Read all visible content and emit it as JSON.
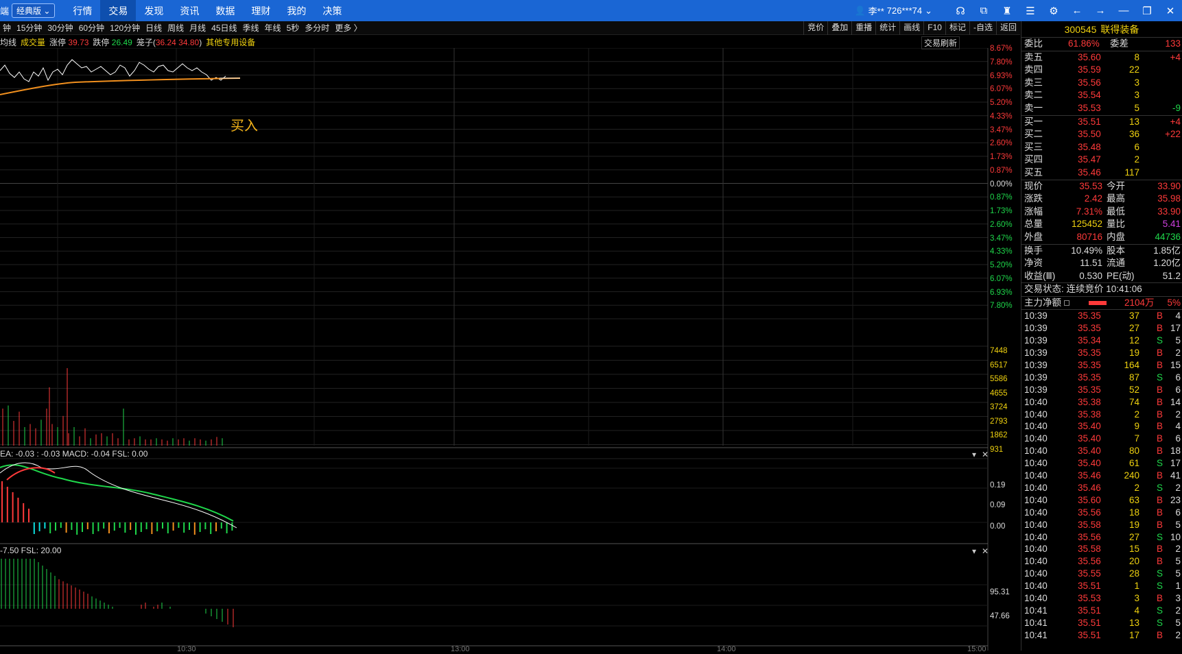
{
  "topbar": {
    "brand": "端",
    "edition": "经典版",
    "menu": [
      "行情",
      "交易",
      "发现",
      "资讯",
      "数据",
      "理财",
      "我的",
      "决策"
    ],
    "active_menu": "交易",
    "user_name": "李**",
    "user_account": "726***74"
  },
  "toolbar": {
    "periods": [
      "钟",
      "15分钟",
      "30分钟",
      "60分钟",
      "120分钟",
      "日线",
      "周线",
      "月线",
      "45日线",
      "季线",
      "年线",
      "5秒",
      "多分时",
      "更多 〉"
    ],
    "tools": [
      "竞价",
      "叠加",
      "重播",
      "统计",
      "画线",
      "F10",
      "标记",
      "-自选",
      "返回"
    ]
  },
  "infobar": {
    "kind": "均线",
    "vol": "成交量",
    "limit_up_label": "涨停",
    "limit_up": "39.73",
    "limit_down_label": "跌停",
    "limit_down": "26.49",
    "box_label": "笼子(",
    "box": "36.24 34.80",
    ")": ")",
    "sector": "其他专用设备",
    "refresh": "交易刷新"
  },
  "annotation": {
    "buy": "买入"
  },
  "price_axis": {
    "up": [
      "8.67%",
      "7.80%",
      "6.93%",
      "6.07%",
      "5.20%",
      "4.33%",
      "3.47%",
      "2.60%",
      "1.73%",
      "0.87%"
    ],
    "zero": "0.00%",
    "down": [
      "0.87%",
      "1.73%",
      "2.60%",
      "3.47%",
      "4.33%",
      "5.20%",
      "6.07%",
      "6.93%",
      "7.80%"
    ]
  },
  "vol_axis": [
    "7448",
    "6517",
    "5586",
    "4655",
    "3724",
    "2793",
    "1862",
    "931"
  ],
  "macd": {
    "header": "EA: -0.03  : -0.03  MACD: -0.04  FSL: 0.00",
    "axis": [
      "0.19",
      "0.09",
      "0.00"
    ]
  },
  "kdj": {
    "header": "-7.50  FSL: 20.00",
    "axis": [
      "95.31",
      "47.66"
    ]
  },
  "time_axis": [
    "10:30",
    "13:00",
    "14:00",
    "15:00"
  ],
  "side": {
    "code": "300545",
    "name": "联得装备",
    "weibi_label": "委比",
    "weibi": "61.86%",
    "weicha_label": "委差",
    "weicha": "133",
    "asks": [
      {
        "label": "卖五",
        "price": "35.60",
        "vol": "8",
        "chg": "+4"
      },
      {
        "label": "卖四",
        "price": "35.59",
        "vol": "22",
        "chg": ""
      },
      {
        "label": "卖三",
        "price": "35.56",
        "vol": "3",
        "chg": ""
      },
      {
        "label": "卖二",
        "price": "35.54",
        "vol": "3",
        "chg": ""
      },
      {
        "label": "卖一",
        "price": "35.53",
        "vol": "5",
        "chg": "-9"
      }
    ],
    "bids": [
      {
        "label": "买一",
        "price": "35.51",
        "vol": "13",
        "chg": "+4"
      },
      {
        "label": "买二",
        "price": "35.50",
        "vol": "36",
        "chg": "+22"
      },
      {
        "label": "买三",
        "price": "35.48",
        "vol": "6",
        "chg": ""
      },
      {
        "label": "买四",
        "price": "35.47",
        "vol": "2",
        "chg": ""
      },
      {
        "label": "买五",
        "price": "35.46",
        "vol": "117",
        "chg": ""
      }
    ],
    "quote": [
      {
        "l1": "现价",
        "v1": "35.53",
        "c1": "red",
        "l2": "今开",
        "v2": "33.90",
        "c2": "red"
      },
      {
        "l1": "涨跌",
        "v1": "2.42",
        "c1": "red",
        "l2": "最高",
        "v2": "35.98",
        "c2": "red"
      },
      {
        "l1": "涨幅",
        "v1": "7.31%",
        "c1": "red",
        "l2": "最低",
        "v2": "33.90",
        "c2": "red"
      },
      {
        "l1": "总量",
        "v1": "125452",
        "c1": "yellow",
        "l2": "量比",
        "v2": "5.41",
        "c2": "mag"
      },
      {
        "l1": "外盘",
        "v1": "80716",
        "c1": "red",
        "l2": "内盘",
        "v2": "44736",
        "c2": "green"
      }
    ],
    "stats": [
      {
        "l1": "换手",
        "v1": "10.49%",
        "l2": "股本",
        "v2": "1.85亿"
      },
      {
        "l1": "净资",
        "v1": "11.51",
        "l2": "流通",
        "v2": "1.20亿"
      },
      {
        "l1": "收益(Ⅲ)",
        "v1": "0.530",
        "l2": "PE(动)",
        "v2": "51.2"
      }
    ],
    "status": "交易状态: 连续竞价 10:41:06",
    "main_flow_label": "主力净额",
    "main_flow": "2104万",
    "main_flow_pct": "5%",
    "ticks": [
      {
        "t": "10:39",
        "p": "35.35",
        "v": "37",
        "bs": "B",
        "n": "4"
      },
      {
        "t": "10:39",
        "p": "35.35",
        "v": "27",
        "bs": "B",
        "n": "17"
      },
      {
        "t": "10:39",
        "p": "35.34",
        "v": "12",
        "bs": "S",
        "n": "5"
      },
      {
        "t": "10:39",
        "p": "35.35",
        "v": "19",
        "bs": "B",
        "n": "2"
      },
      {
        "t": "10:39",
        "p": "35.35",
        "v": "164",
        "bs": "B",
        "n": "15"
      },
      {
        "t": "10:39",
        "p": "35.35",
        "v": "87",
        "bs": "S",
        "n": "6"
      },
      {
        "t": "10:39",
        "p": "35.35",
        "v": "52",
        "bs": "B",
        "n": "6"
      },
      {
        "t": "10:40",
        "p": "35.38",
        "v": "74",
        "bs": "B",
        "n": "14"
      },
      {
        "t": "10:40",
        "p": "35.38",
        "v": "2",
        "bs": "B",
        "n": "2"
      },
      {
        "t": "10:40",
        "p": "35.40",
        "v": "9",
        "bs": "B",
        "n": "4"
      },
      {
        "t": "10:40",
        "p": "35.40",
        "v": "7",
        "bs": "B",
        "n": "6"
      },
      {
        "t": "10:40",
        "p": "35.40",
        "v": "80",
        "bs": "B",
        "n": "18"
      },
      {
        "t": "10:40",
        "p": "35.40",
        "v": "61",
        "bs": "S",
        "n": "17"
      },
      {
        "t": "10:40",
        "p": "35.46",
        "v": "240",
        "bs": "B",
        "n": "41"
      },
      {
        "t": "10:40",
        "p": "35.46",
        "v": "2",
        "bs": "S",
        "n": "2"
      },
      {
        "t": "10:40",
        "p": "35.60",
        "v": "63",
        "bs": "B",
        "n": "23"
      },
      {
        "t": "10:40",
        "p": "35.56",
        "v": "18",
        "bs": "B",
        "n": "6"
      },
      {
        "t": "10:40",
        "p": "35.58",
        "v": "19",
        "bs": "B",
        "n": "5"
      },
      {
        "t": "10:40",
        "p": "35.56",
        "v": "27",
        "bs": "S",
        "n": "10"
      },
      {
        "t": "10:40",
        "p": "35.58",
        "v": "15",
        "bs": "B",
        "n": "2"
      },
      {
        "t": "10:40",
        "p": "35.56",
        "v": "20",
        "bs": "B",
        "n": "5"
      },
      {
        "t": "10:40",
        "p": "35.55",
        "v": "28",
        "bs": "S",
        "n": "5"
      },
      {
        "t": "10:40",
        "p": "35.51",
        "v": "1",
        "bs": "S",
        "n": "1"
      },
      {
        "t": "10:40",
        "p": "35.53",
        "v": "3",
        "bs": "B",
        "n": "3"
      },
      {
        "t": "10:41",
        "p": "35.51",
        "v": "4",
        "bs": "S",
        "n": "2"
      },
      {
        "t": "10:41",
        "p": "35.51",
        "v": "13",
        "bs": "S",
        "n": "5"
      },
      {
        "t": "10:41",
        "p": "35.51",
        "v": "17",
        "bs": "B",
        "n": "2"
      }
    ]
  },
  "colors": {
    "up": "#ff3a3a",
    "down": "#1fd84b",
    "accent": "#1a66d4"
  }
}
